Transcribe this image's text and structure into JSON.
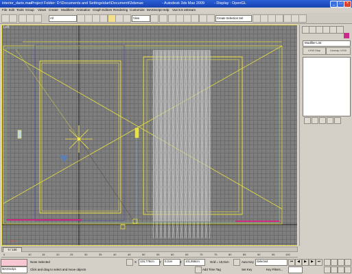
{
  "window": {
    "file": "interior_dario.max",
    "project": "- Project Folder: D:\\Documents and Settings\\dari\\Documenti\\3dsmax",
    "app": "- Autodesk 3ds Max 2009",
    "display": "- Display : OpenGL"
  },
  "menu": [
    "File",
    "Edit",
    "Tools",
    "Group",
    "Views",
    "Create",
    "Modifiers",
    "Animation",
    "Graph Editors",
    "Rendering",
    "Customize",
    "MAXScript",
    "Help",
    "Vue 8.5 xStream"
  ],
  "toolbar": {
    "filter": "All",
    "refcoord": "View",
    "selection_set": "Create Selection Set"
  },
  "viewport": {
    "label": "Left"
  },
  "command_panel": {
    "modifier_list": "Modifier List",
    "uvw_map": "UVW Map",
    "unwrap_uvw": "Unwrap UVW",
    "accent": "#cc2a8a"
  },
  "timeline": {
    "frame": "0 / 100",
    "ticks": [
      "0",
      "10",
      "15",
      "20",
      "25",
      "30",
      "35",
      "40",
      "45",
      "50",
      "55",
      "60",
      "65",
      "70",
      "75",
      "80",
      "85",
      "90",
      "95",
      "100"
    ]
  },
  "status": {
    "maxscript": "MAXScript.",
    "selection": "None Selected",
    "prompt": "Click and drag to select and move objects",
    "x": "134,778cm",
    "y": "0,0cm",
    "z": "101,858cm",
    "grid": "Grid = 10,0cm",
    "add_time_tag": "Add Time Tag",
    "auto_key": "Auto Key",
    "key_mode": "Selected",
    "set_key": "Set Key",
    "key_filters": "Key Filters..."
  }
}
